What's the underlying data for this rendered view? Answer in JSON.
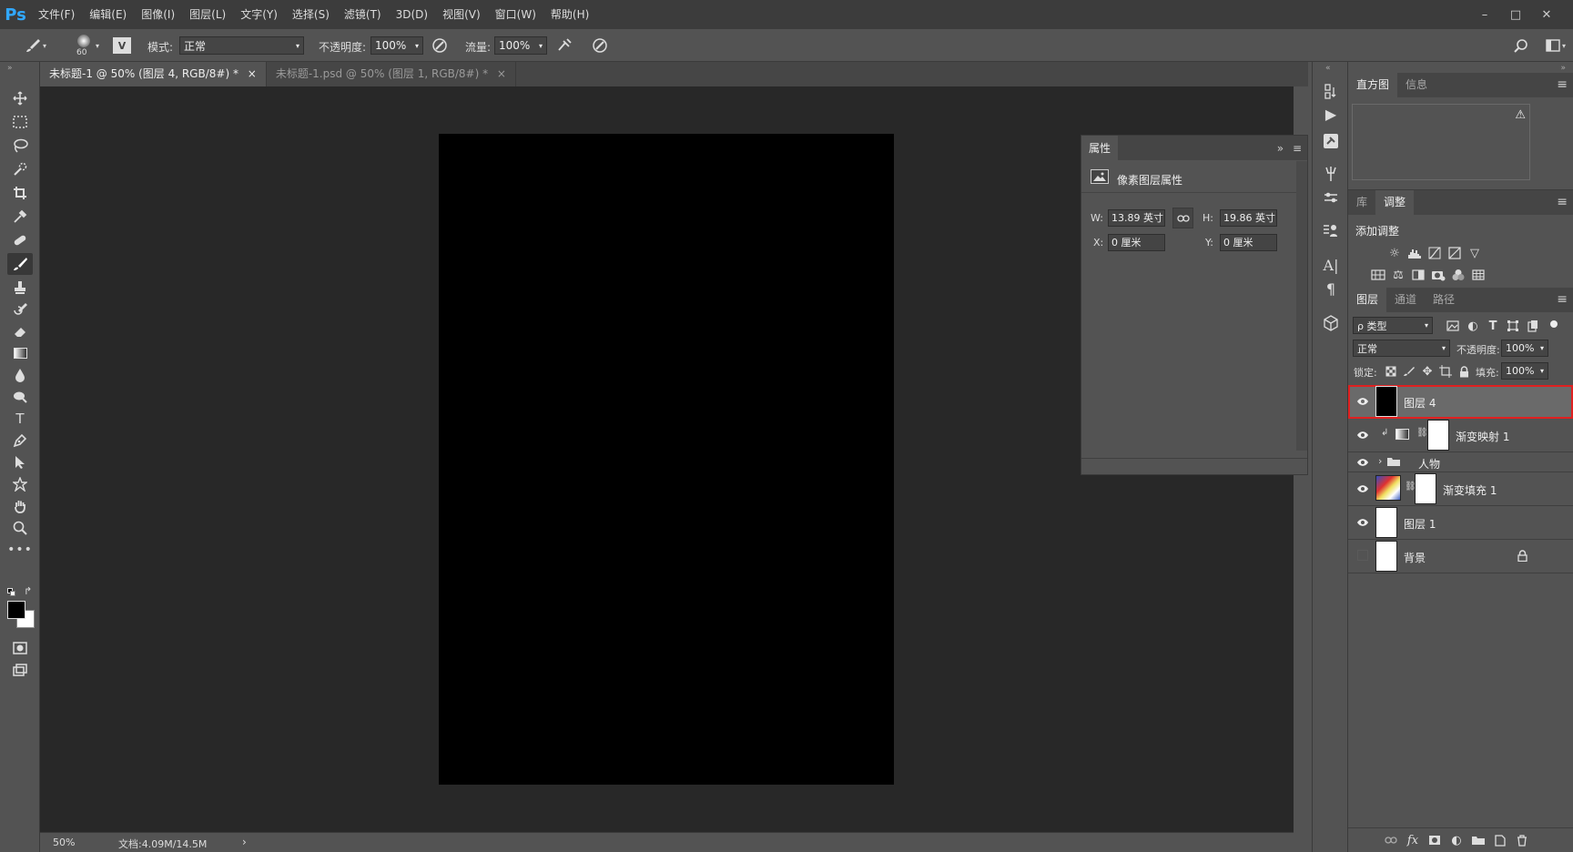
{
  "app": {
    "logo": "Ps"
  },
  "menubar": {
    "items": [
      "文件(F)",
      "编辑(E)",
      "图像(I)",
      "图层(L)",
      "文字(Y)",
      "选择(S)",
      "滤镜(T)",
      "3D(D)",
      "视图(V)",
      "窗口(W)",
      "帮助(H)"
    ],
    "window_buttons": [
      "–",
      "□",
      "✕"
    ]
  },
  "options": {
    "brush_size": "60",
    "mode_label": "模式:",
    "mode_value": "正常",
    "opacity_label": "不透明度:",
    "opacity_value": "100%",
    "flow_label": "流量:",
    "flow_value": "100%"
  },
  "tabs": [
    {
      "label": "未标题-1 @ 50% (图层 4, RGB/8#) *",
      "close": "×"
    },
    {
      "label": "未标题-1.psd @ 50% (图层 1, RGB/8#) *",
      "close": "×"
    }
  ],
  "status": {
    "zoom": "50%",
    "doc": "文档:4.09M/14.5M",
    "arrow": "›"
  },
  "properties": {
    "title": "属性",
    "subtitle": "像素图层属性",
    "w_label": "W:",
    "w_value": "13.89 英寸",
    "h_label": "H:",
    "h_value": "19.86 英寸",
    "x_label": "X:",
    "x_value": "0 厘米",
    "y_label": "Y:",
    "y_value": "0 厘米",
    "expand": "»",
    "menu": "≡"
  },
  "histogram_panel": {
    "tabs": [
      "直方图",
      "信息"
    ],
    "warning": "⚠"
  },
  "adjust_panel": {
    "tabs": [
      "库",
      "调整"
    ],
    "title": "添加调整"
  },
  "layers_panel": {
    "tabs": [
      "图层",
      "通道",
      "路径"
    ],
    "filter": "ρ 类型",
    "blend_mode": "正常",
    "opacity_label": "不透明度:",
    "opacity_value": "100%",
    "lock_label": "锁定:",
    "fill_label": "填充:",
    "fill_value": "100%",
    "layers": [
      {
        "name": "图层 4",
        "selected": true,
        "visible": true
      },
      {
        "name": "渐变映射 1",
        "visible": true
      },
      {
        "name": "人物",
        "visible": true
      },
      {
        "name": "渐变填充 1",
        "visible": true
      },
      {
        "name": "图层 1",
        "visible": true
      },
      {
        "name": "背景",
        "visible": false
      }
    ]
  },
  "colors": {
    "selection_outline": "#e02020",
    "accent": "#31a8ff"
  }
}
